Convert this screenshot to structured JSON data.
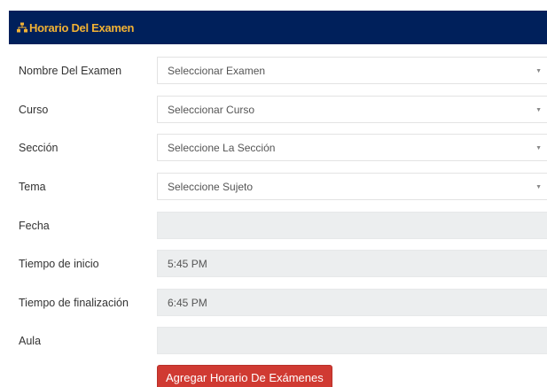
{
  "header": {
    "title": "Horario Del Examen",
    "icon": "sitemap-icon",
    "background": "#00205b",
    "title_color": "#f2b234"
  },
  "form": {
    "exam_name": {
      "label": "Nombre Del Examen",
      "value": "Seleccionar Examen"
    },
    "course": {
      "label": "Curso",
      "value": "Seleccionar Curso"
    },
    "section": {
      "label": "Sección",
      "value": "Seleccione La Sección"
    },
    "subject": {
      "label": "Tema",
      "value": "Seleccione Sujeto"
    },
    "date": {
      "label": "Fecha",
      "value": ""
    },
    "start_time": {
      "label": "Tiempo de inicio",
      "value": "5:45 PM"
    },
    "end_time": {
      "label": "Tiempo de finalización",
      "value": "6:45 PM"
    },
    "room": {
      "label": "Aula",
      "value": ""
    }
  },
  "submit": {
    "label": "Agregar Horario De Exámenes",
    "color": "#d03a32"
  }
}
